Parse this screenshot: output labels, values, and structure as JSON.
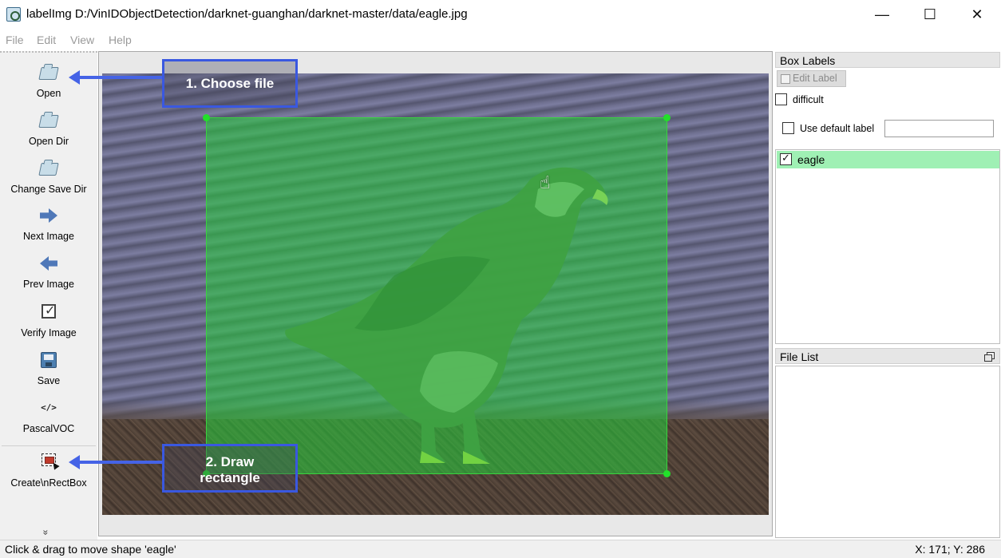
{
  "window": {
    "title": "labelImg D:/VinIDObjectDetection/darknet-guanghan/darknet-master/data/eagle.jpg",
    "minimize_glyph": "—",
    "maximize_glyph": "☐",
    "close_glyph": "✕"
  },
  "menu": [
    "File",
    "Edit",
    "View",
    "Help"
  ],
  "toolbar": [
    {
      "label": "Open",
      "icon": "folder-open-icon"
    },
    {
      "label": "Open Dir",
      "icon": "folder-open-icon"
    },
    {
      "label": "Change Save Dir",
      "icon": "folder-open-icon"
    },
    {
      "label": "Next Image",
      "icon": "arrow-right-icon"
    },
    {
      "label": "Prev Image",
      "icon": "arrow-left-icon"
    },
    {
      "label": "Verify Image",
      "icon": "checkbox-icon"
    },
    {
      "label": "Save",
      "icon": "floppy-disk-icon"
    },
    {
      "label": "PascalVOC",
      "icon": "code-tag-icon",
      "glyph": "</>"
    },
    {
      "label": "Create\\nRectBox",
      "icon": "draw-rectangle-icon"
    }
  ],
  "toolbar_more_glyph": "»",
  "annotations": {
    "step1": "1. Choose file",
    "step2_line1": "2. Draw",
    "step2_line2": "rectangle"
  },
  "canvas": {
    "image_subject": "eagle",
    "box_label": "eagle",
    "box_color": "#2ec83c",
    "cursor_glyph": "☝"
  },
  "box_labels_dock": {
    "title": "Box Labels",
    "edit_label_button": "Edit Label",
    "difficult_label": "difficult",
    "difficult_checked": false,
    "use_default_label": "Use default label",
    "use_default_checked": false,
    "default_label_value": "",
    "labels": [
      {
        "text": "eagle",
        "checked": true,
        "color": "#9ff0b4"
      }
    ]
  },
  "file_list_dock": {
    "title": "File List",
    "files": []
  },
  "status": {
    "message": "Click & drag to move shape 'eagle'",
    "coords": "X: 171; Y: 286"
  },
  "colors": {
    "accent": "#3a58e0",
    "selection": "#9ff0b4"
  }
}
